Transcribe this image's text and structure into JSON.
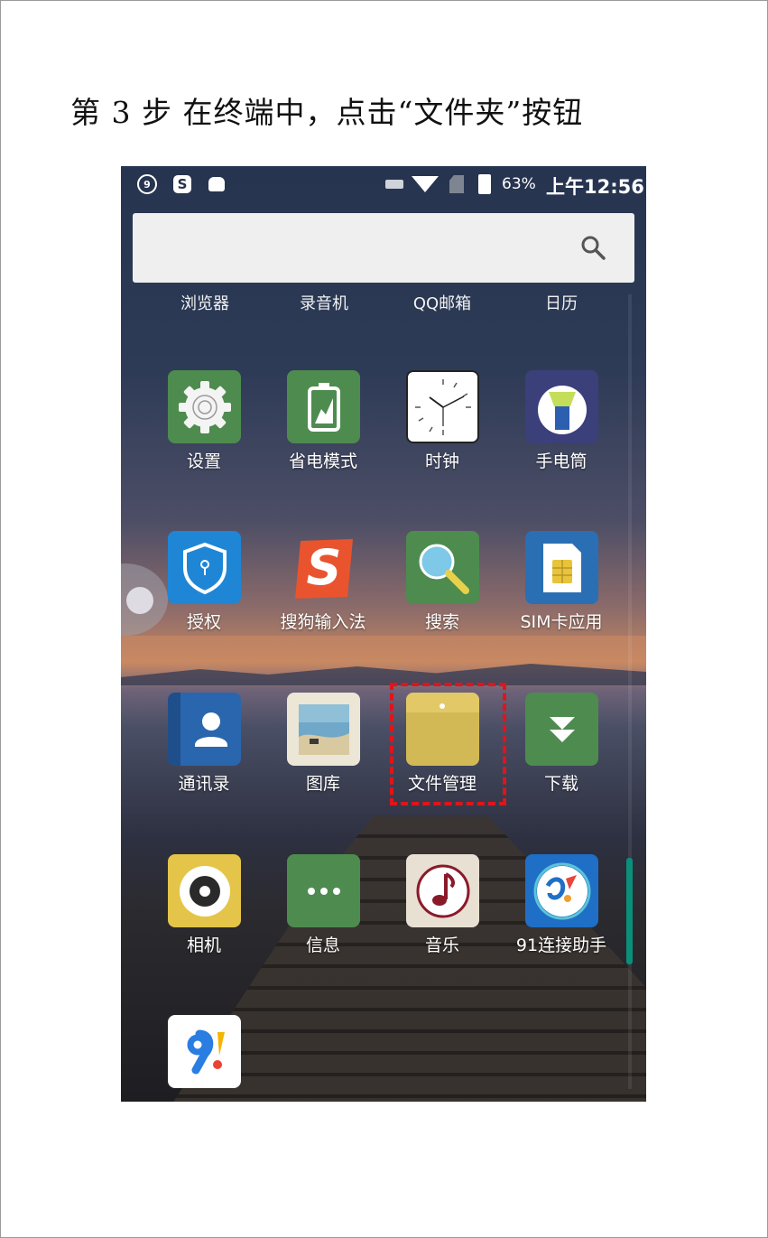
{
  "document": {
    "step_title": "第 3 步  在终端中，点击“文件夹”按钮"
  },
  "status_bar": {
    "icons": [
      "91-assistant-icon",
      "sogou-icon",
      "android-debug-icon",
      "keyboard-icon",
      "wifi-icon",
      "no-sim-icon",
      "battery-charging-icon"
    ],
    "battery_percent": "63%",
    "time": "上午12:56",
    "colors": {
      "text": "#ffffff"
    }
  },
  "search": {
    "icon": "search-icon",
    "placeholder": ""
  },
  "top_row": [
    "浏览器",
    "录音机",
    "QQ邮箱",
    "日历"
  ],
  "apps": [
    {
      "label": "设置",
      "icon": "gear-icon",
      "color": "#4e8b4f"
    },
    {
      "label": "省电模式",
      "icon": "battery-save-icon",
      "color": "#4e8b4f"
    },
    {
      "label": "时钟",
      "icon": "clock-icon",
      "color": "#ffffff"
    },
    {
      "label": "手电筒",
      "icon": "flashlight-icon",
      "color": "#3b3f7a"
    },
    {
      "label": "授权",
      "icon": "shield-icon",
      "color": "#1f86d6"
    },
    {
      "label": "搜狗输入法",
      "icon": "sogou-s-icon",
      "color": "#e9542e"
    },
    {
      "label": "搜索",
      "icon": "magnifier-icon",
      "color": "#4e8b4f"
    },
    {
      "label": "SIM卡应用",
      "icon": "sim-card-icon",
      "color": "#2a6fb3"
    },
    {
      "label": "通讯录",
      "icon": "contacts-icon",
      "color": "#2a66ad"
    },
    {
      "label": "图库",
      "icon": "gallery-icon",
      "color": "#ece6d6"
    },
    {
      "label": "文件管理",
      "icon": "folder-icon",
      "color": "#d3b955"
    },
    {
      "label": "下载",
      "icon": "download-icon",
      "color": "#4e8b4f"
    },
    {
      "label": "相机",
      "icon": "camera-icon",
      "color": "#e4c549"
    },
    {
      "label": "信息",
      "icon": "message-icon",
      "color": "#4e8b4f"
    },
    {
      "label": "音乐",
      "icon": "music-note-icon",
      "color": "#e8e0d2"
    },
    {
      "label": "91连接助手",
      "icon": "91-connect-icon",
      "color": "#1f6fc6"
    },
    {
      "label": "",
      "icon": "91-logo-icon",
      "color": "#ffffff"
    }
  ],
  "highlight": {
    "target": "文件管理",
    "color": "#e0141a"
  }
}
